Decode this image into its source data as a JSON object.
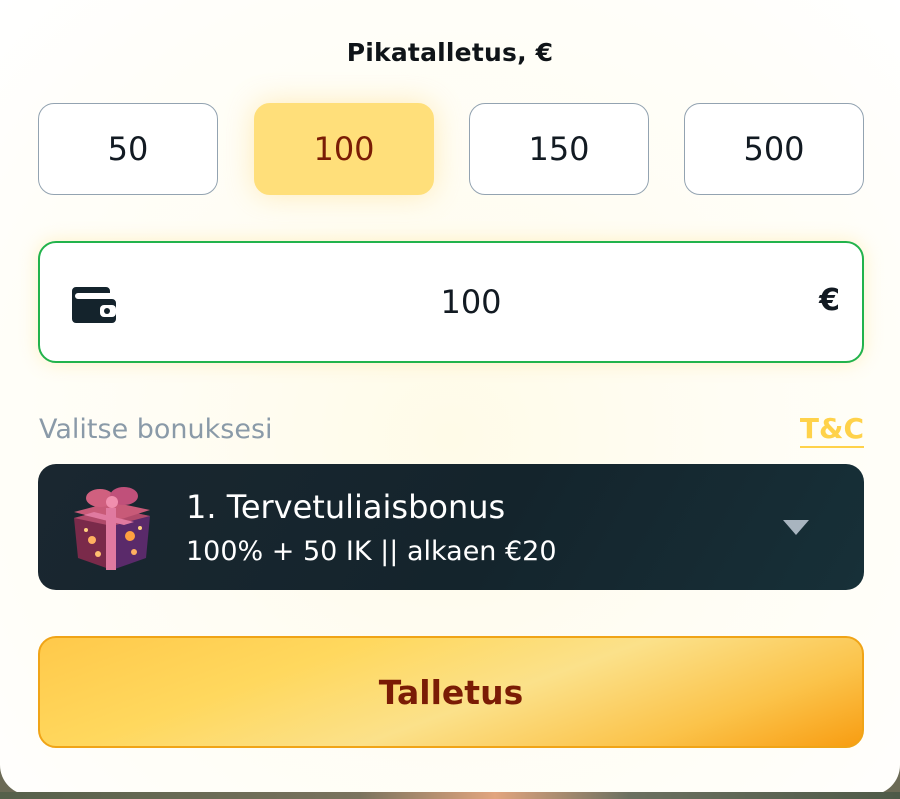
{
  "title": "Pikatalletus, €",
  "quick_amounts": [
    {
      "label": "50",
      "selected": false
    },
    {
      "label": "100",
      "selected": true
    },
    {
      "label": "150",
      "selected": false
    },
    {
      "label": "500",
      "selected": false
    }
  ],
  "amount_field": {
    "icon": "wallet-icon",
    "value": "100",
    "currency": "€"
  },
  "bonus": {
    "label": "Valitse bonuksesi",
    "tc_link": "T&C",
    "selected": {
      "icon": "gift-box-icon",
      "title": "1. Tervetuliaisbonus",
      "description": "100% + 50 IK || alkaen €20"
    }
  },
  "deposit_button": {
    "label": "Talletus"
  },
  "colors": {
    "selected_amount_bg": "#ffdf7a",
    "field_border": "#22b34c",
    "tc_link": "#ffd24a",
    "bonus_bg": "#14242c",
    "deposit_bg": "#ffd85e",
    "deposit_text": "#7a1c05"
  }
}
